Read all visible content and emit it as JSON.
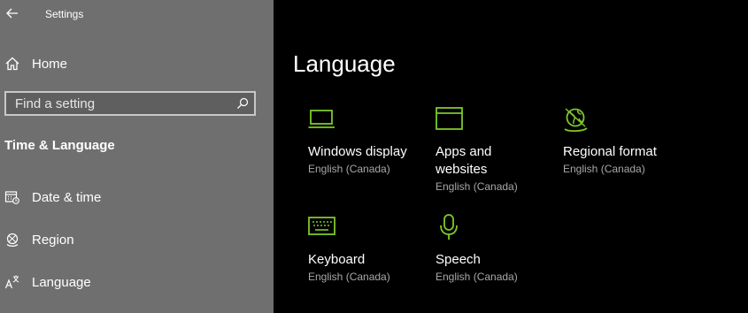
{
  "window": {
    "title": "Settings"
  },
  "sidebar": {
    "home_label": "Home",
    "search_placeholder": "Find a setting",
    "section_heading": "Time & Language",
    "items": [
      {
        "label": "Date & time"
      },
      {
        "label": "Region"
      },
      {
        "label": "Language"
      }
    ]
  },
  "main": {
    "title": "Language",
    "tiles": [
      {
        "name": "Windows display",
        "sub": "English (Canada)",
        "icon": "laptop-icon"
      },
      {
        "name": "Apps and websites",
        "sub": "English (Canada)",
        "icon": "window-icon"
      },
      {
        "name": "Regional format",
        "sub": "English (Canada)",
        "icon": "globe-icon"
      },
      {
        "name": "Keyboard",
        "sub": "English (Canada)",
        "icon": "keyboard-icon"
      },
      {
        "name": "Speech",
        "sub": "English (Canada)",
        "icon": "microphone-icon"
      }
    ]
  },
  "colors": {
    "accent": "#7ec82a",
    "sidebar_bg": "#6f6f6f",
    "main_bg": "#000000",
    "subtext": "#a8a8a8"
  }
}
